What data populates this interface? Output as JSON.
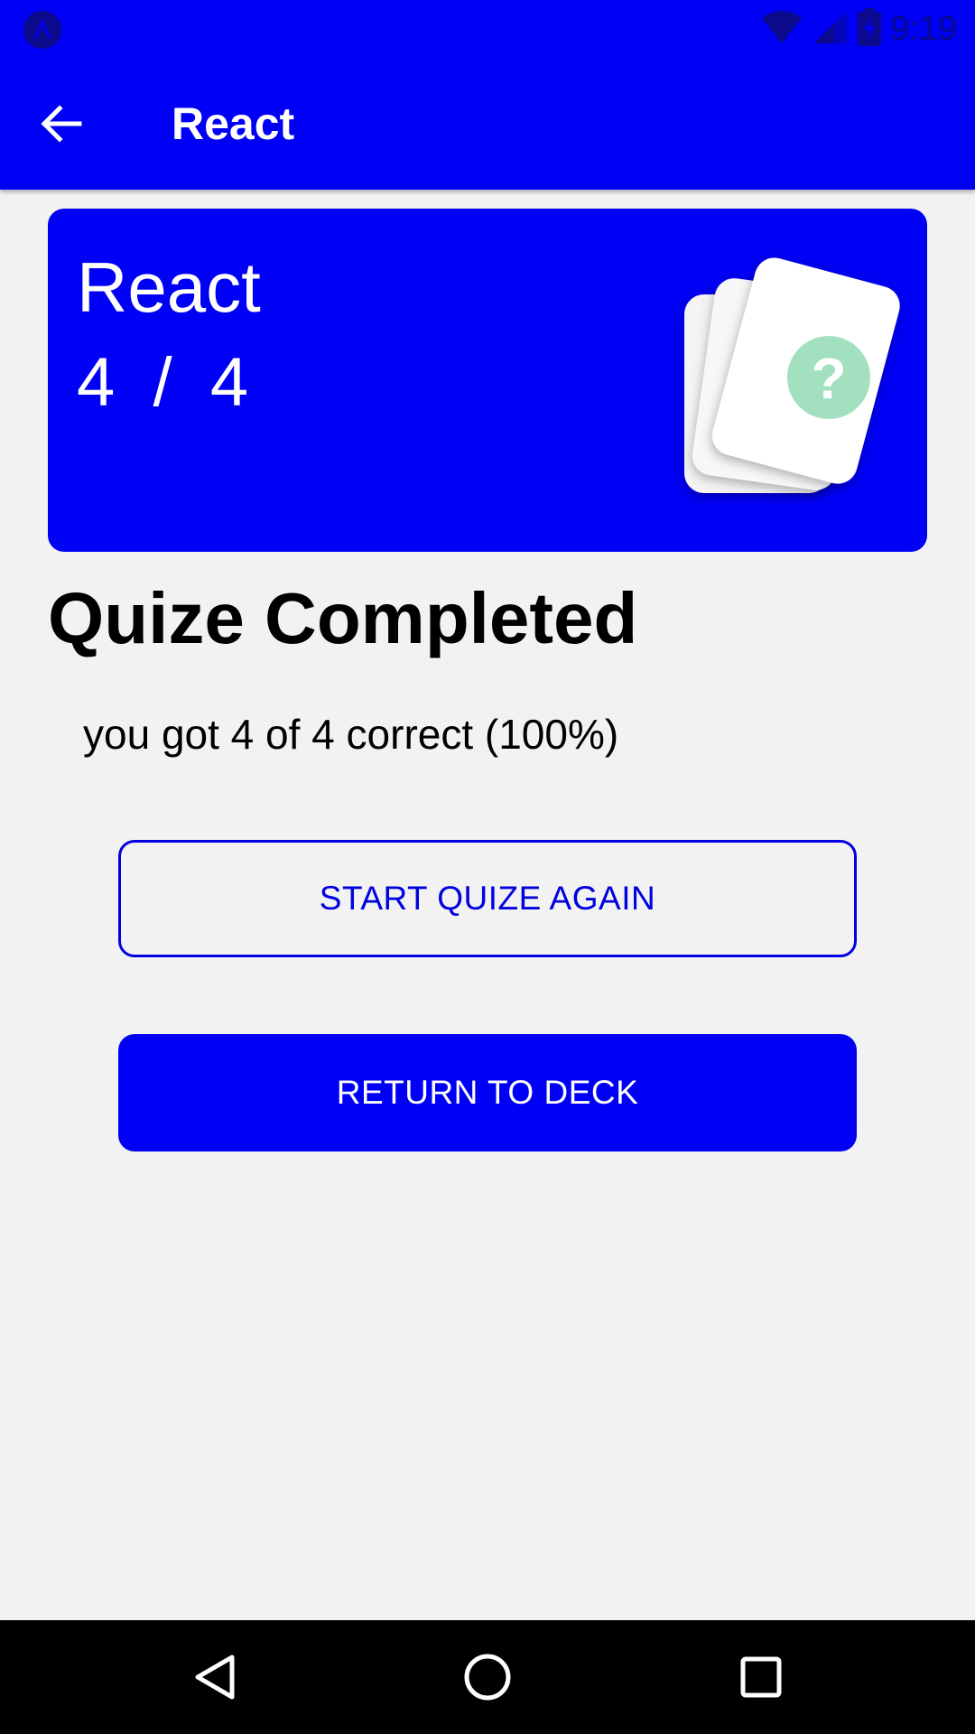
{
  "status_bar": {
    "time": "9:19",
    "icons": [
      "app-icon",
      "wifi-icon",
      "signal-icon",
      "battery-charging-icon"
    ]
  },
  "app_bar": {
    "title": "React",
    "back_icon": "arrow-left-icon"
  },
  "deck_card": {
    "name": "React",
    "progress": "4  /  4",
    "illustration": "question-cards-icon"
  },
  "result": {
    "heading": "Quize Completed",
    "summary": "you got 4 of 4 correct (100%)"
  },
  "buttons": {
    "restart_label": "START QUIZE AGAIN",
    "return_label": "RETURN TO DECK"
  },
  "nav_bar": {
    "icons": [
      "back-triangle-icon",
      "home-circle-icon",
      "recents-square-icon"
    ]
  },
  "colors": {
    "primary": "#0000f5",
    "background": "#f2f2f2",
    "question_badge": "#a3e0bf"
  }
}
